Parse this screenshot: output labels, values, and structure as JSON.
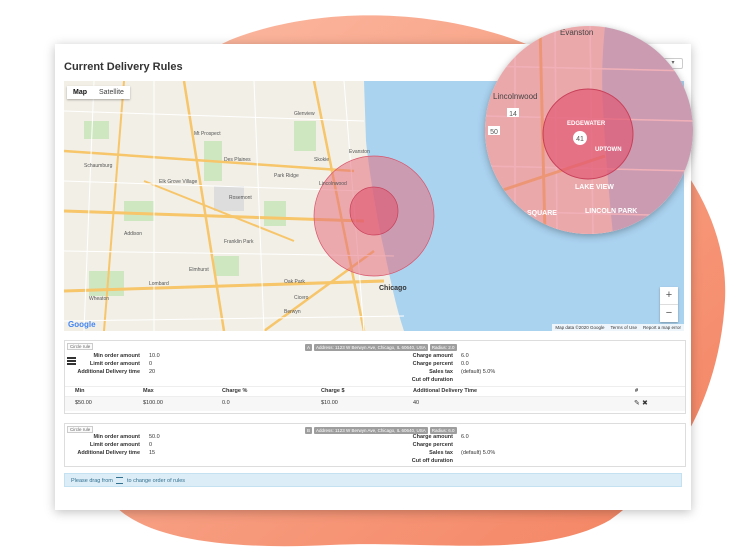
{
  "title": "Current Delivery Rules",
  "top_control": "▾",
  "map": {
    "tabs": [
      "Map",
      "Satellite"
    ],
    "zoom_in": "+",
    "zoom_out": "−",
    "logo": "Google",
    "attribution": [
      "Map data ©2020 Google",
      "Terms of Use",
      "Report a map error"
    ],
    "labels": [
      "Schaumburg",
      "Des Plaines",
      "Mt Prospect",
      "Elk Grove Village",
      "Rosemont",
      "Franklin Park",
      "Elmhurst",
      "Oak Park",
      "Chicago",
      "Evanston",
      "Skokie",
      "Lincolnwood",
      "Wheaton",
      "Addison",
      "Lombard",
      "Cicero",
      "Berwyn",
      "Glenview",
      "Park Ridge"
    ]
  },
  "zoom_inset": {
    "labels": [
      "Lincolnwood",
      "EDGEWATER",
      "UPTOWN",
      "LAKE VIEW",
      "LINCOLN PARK",
      "SQUARE",
      "Evanston"
    ]
  },
  "rules": [
    {
      "tag": "Circle rule",
      "letter": "A",
      "address": "Address: 1123 W Berwyn Ave, Chicago, IL 60640, USA",
      "radius": "Radius: 2.0",
      "min_label": "Min order amount",
      "min": "10.0",
      "limit_label": "Limit order amount",
      "limit": "0",
      "adt_label": "Additional Delivery time",
      "adt": "20",
      "ca_label": "Charge amount",
      "ca": "6.0",
      "cp_label": "Charge percent",
      "cp": "0.0",
      "st_label": "Sales tax",
      "st": "(default) 5.0%",
      "co_label": "Cut off duration",
      "co": "",
      "table": {
        "headers": [
          "Min",
          "Max",
          "Charge %",
          "Charge $",
          "Additional Delivery Time",
          "#"
        ],
        "row": [
          "$50.00",
          "$100.00",
          "0.0",
          "$10.00",
          "40"
        ]
      }
    },
    {
      "tag": "Circle rule",
      "letter": "B",
      "address": "Address: 1123 W Berwyn Ave, Chicago, IL 60640, USA",
      "radius": "Radius: 6.0",
      "min_label": "Min order amount",
      "min": "50.0",
      "limit_label": "Limit order amount",
      "limit": "0",
      "adt_label": "Additional Delivery time",
      "adt": "15",
      "ca_label": "Charge amount",
      "ca": "6.0",
      "cp_label": "Charge percent",
      "cp": "",
      "st_label": "Sales tax",
      "st": "(default) 5.0%",
      "co_label": "Cut off duration",
      "co": ""
    }
  ],
  "info": {
    "prefix": "Please drag from",
    "suffix": "to change order of rules"
  },
  "colors": {
    "accent_blob": "#f4845f",
    "water": "#aad3f0",
    "circle": "#e5707e",
    "link": "#31708f"
  }
}
